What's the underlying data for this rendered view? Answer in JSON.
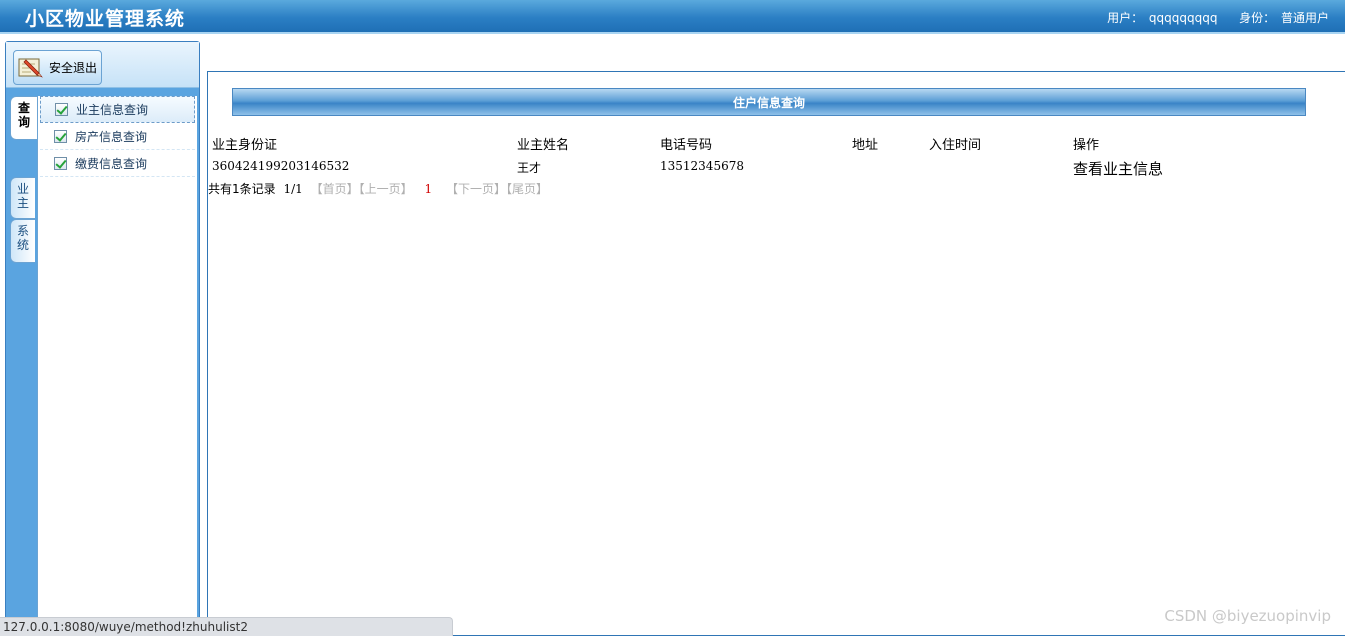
{
  "header": {
    "title": "小区物业管理系统",
    "user_label": "用户：",
    "user_value": "qqqqqqqqq",
    "role_label": "身份：",
    "role_value": "普通用户"
  },
  "sidebar": {
    "logout_label": "安全退出",
    "tabs": [
      {
        "chars": [
          "查",
          "询"
        ]
      },
      {
        "chars": [
          "业",
          "主"
        ]
      },
      {
        "chars": [
          "系",
          "统"
        ]
      }
    ],
    "menu_items": [
      {
        "label": "业主信息查询"
      },
      {
        "label": "房产信息查询"
      },
      {
        "label": "缴费信息查询"
      }
    ]
  },
  "main": {
    "section_title": "住户信息查询",
    "columns": [
      "业主身份证",
      "业主姓名",
      "电话号码",
      "地址",
      "入住时间",
      "操作"
    ],
    "rows": [
      {
        "id_card": "360424199203146532",
        "name": "王才",
        "phone": "13512345678",
        "address": "",
        "move_in": "",
        "action": "查看业主信息"
      }
    ],
    "pager": {
      "total": "共有1条记录",
      "page_info": "1/1",
      "first": "【首页】",
      "prev": "【上一页】",
      "current": "1",
      "next": "【下一页】",
      "last": "【尾页】"
    }
  },
  "status_bar": {
    "url": "127.0.0.1:8080/wuye/method!zhuhulist2"
  },
  "watermark": "CSDN @biyezuopinvip"
}
